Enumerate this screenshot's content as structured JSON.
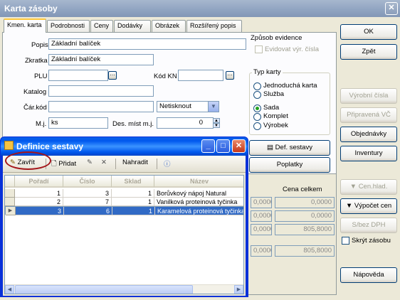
{
  "main_window": {
    "title": "Karta zásoby",
    "close_glyph": "✕",
    "tabs": [
      "Kmen. karta",
      "Podrobnosti",
      "Ceny",
      "Dodávky",
      "Obrázek",
      "Rozšířený popis"
    ],
    "fields": {
      "popis_label": "Popis",
      "popis_value": "Základní balíček",
      "zkratka_label": "Zkratka",
      "zkratka_value": "Základní balíček",
      "plu_label": "PLU",
      "kod_kn_label": "Kód KN",
      "katalog_label": "Katalog",
      "car_kod_label": "Čár.kód",
      "car_kod_select": "Netisknout",
      "mj_label": "M.j.",
      "mj_value": "ks",
      "des_mist_label": "Des. míst m.j.",
      "des_mist_value": "0"
    },
    "zpusob_evidence": {
      "title": "Způsob evidence",
      "checkbox_label": "Evidovat výr. čísla"
    },
    "typ_karty": {
      "title": "Typ karty",
      "options": [
        "Jednoduchá karta",
        "Služba",
        "Sada",
        "Komplet",
        "Výrobek"
      ],
      "selected": "Sada"
    },
    "def_sestavy_button": "Def. sestavy",
    "poplatky_button": "Poplatky",
    "cena_celkem_label": "Cena celkem",
    "bottom_values": [
      "0,0000",
      "0,0000",
      "0,0000",
      "0,0000"
    ],
    "bottom_totals": [
      "0,0000",
      "0,0000",
      "805,8000",
      "805,8000"
    ],
    "right_buttons": {
      "ok": "OK",
      "zpet": "Zpět",
      "vyrobni_cisla": "Výrobní čísla",
      "pripravena_vc": "Připravená VČ",
      "objednavky": "Objednávky",
      "inventury": "Inventury",
      "cen_hlad": "Cen.hlad.",
      "vypocet_cen": "Výpočet cen",
      "s_bez_dph": "S/bez DPH",
      "skryt_zasobu": "Skrýt zásobu",
      "napoveda": "Nápověda"
    }
  },
  "dialog": {
    "title": "Definice sestavy",
    "toolbar": {
      "zavrit": "Zavřít",
      "pridat": "Přidat",
      "nahradit": "Nahradit"
    },
    "grid": {
      "columns": [
        "Pořadí",
        "Číslo",
        "Sklad",
        "Název"
      ],
      "rows": [
        {
          "poradi": "1",
          "cislo": "3",
          "sklad": "1",
          "nazev": "Borůvkový nápoj Natural"
        },
        {
          "poradi": "2",
          "cislo": "7",
          "sklad": "1",
          "nazev": "Vanilková proteinová tyčinka"
        },
        {
          "poradi": "3",
          "cislo": "6",
          "sklad": "1",
          "nazev": "Karamelová proteinová tyčinka"
        }
      ],
      "selected_row": 2
    }
  }
}
